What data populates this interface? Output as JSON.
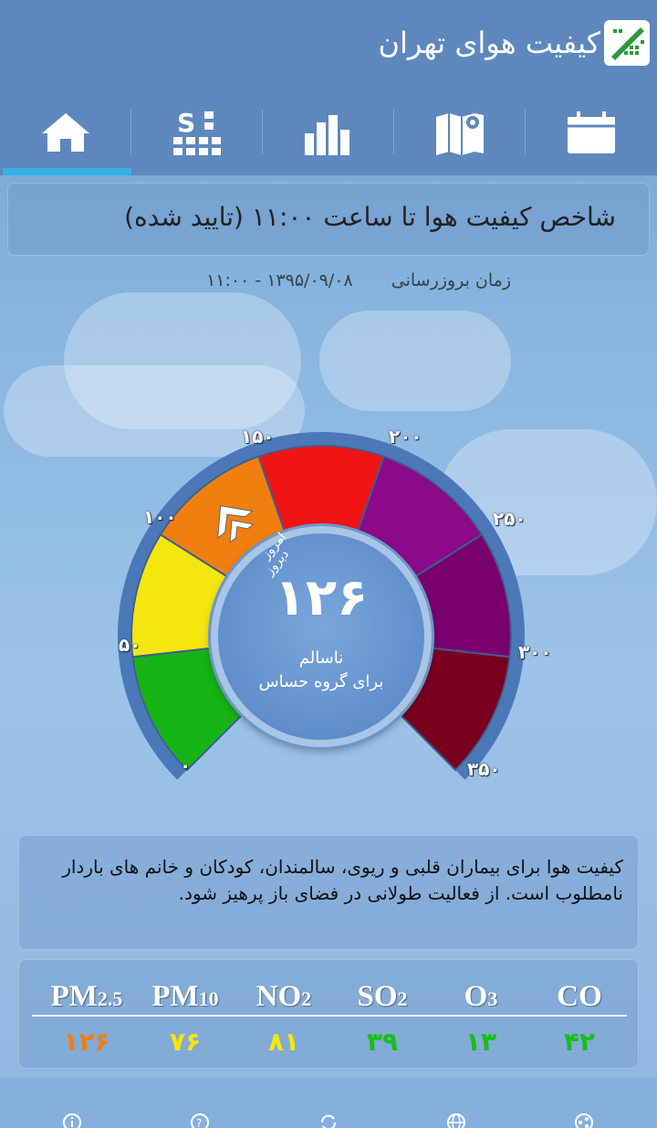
{
  "app": {
    "title": "کیفیت هوای تهران"
  },
  "tabs": [
    {
      "name": "home",
      "icon": "home-icon",
      "active": true
    },
    {
      "name": "stations",
      "icon": "stations-grid-icon",
      "active": false
    },
    {
      "name": "charts",
      "icon": "bar-chart-icon",
      "active": false
    },
    {
      "name": "map",
      "icon": "map-pin-icon",
      "active": false
    },
    {
      "name": "calendar",
      "icon": "calendar-icon",
      "active": false
    }
  ],
  "index": {
    "heading": "شاخص کیفیت هوا تا ساعت ۱۱:۰۰ (تایید شده)",
    "update_label": "زمان بروزرسانی",
    "update_time": "۱۳۹۵/۰۹/۰۸ - ۱۱:۰۰"
  },
  "gauge": {
    "value": "۱۲۶",
    "status_line1": "ناسالم",
    "status_line2": "برای گروه حساس",
    "today_label": "امروز",
    "yesterday_label": "دیروز",
    "ticks": [
      "۰",
      "۵۰",
      "۱۰۰",
      "۱۵۰",
      "۲۰۰",
      "۲۵۰",
      "۳۰۰",
      "۳۵۰"
    ],
    "colors": [
      "#16b316",
      "#f5e60e",
      "#f07f10",
      "#f21414",
      "#8a0a8a",
      "#7a0070",
      "#7a0020"
    ],
    "aqi_numeric": 126
  },
  "description": "کیفیت هوا برای بیماران قلبی و ریوی، سالمندان، کودکان و خانم های باردار نامطلوب است. از فعالیت طولانی در فضای باز پرهیز شود.",
  "pollutants": [
    {
      "base": "PM",
      "sub": "2.5",
      "value": "۱۲۶",
      "color": "#f07f10"
    },
    {
      "base": "PM",
      "sub": "10",
      "value": "۷۶",
      "color": "#f5e60e"
    },
    {
      "base": "NO",
      "sub": "2",
      "value": "۸۱",
      "color": "#f5e60e"
    },
    {
      "base": "SO",
      "sub": "2",
      "value": "۳۹",
      "color": "#16c016"
    },
    {
      "base": "O",
      "sub": "3",
      "value": "۱۳",
      "color": "#16c016"
    },
    {
      "base": "CO",
      "sub": "",
      "value": "۴۲",
      "color": "#16c016"
    }
  ],
  "bottom_icons": [
    "info-icon",
    "help-icon",
    "refresh-icon",
    "globe-icon",
    "share-icon"
  ]
}
